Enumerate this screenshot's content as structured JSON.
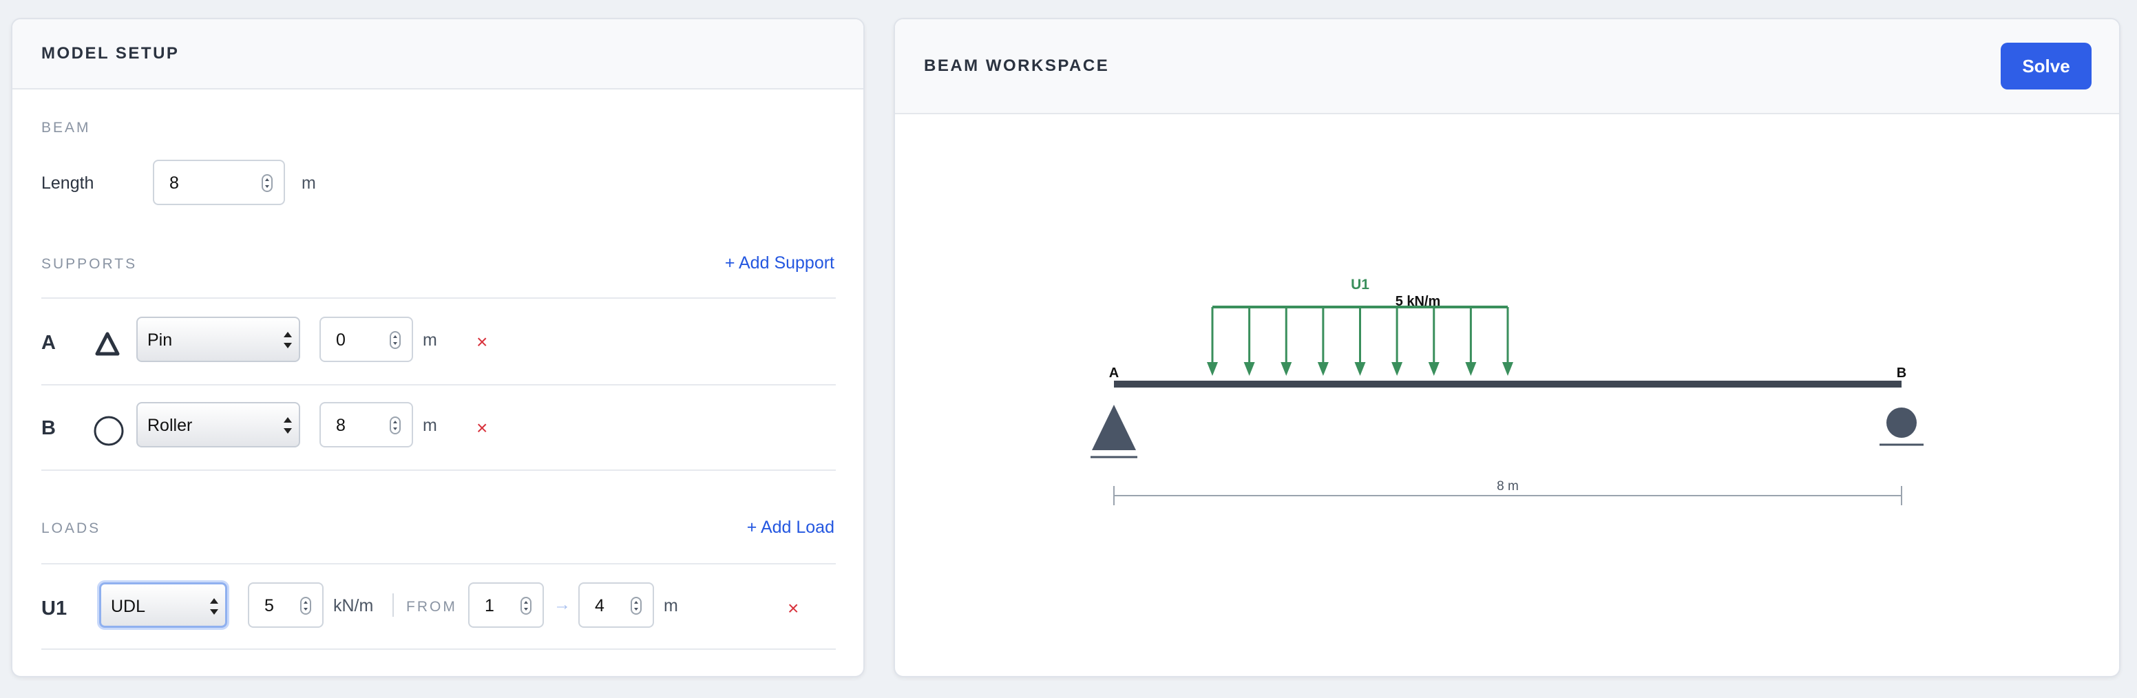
{
  "model_setup": {
    "title": "MODEL SETUP",
    "beam": {
      "section_label": "BEAM",
      "length_label": "Length",
      "length_value": "8",
      "length_unit": "m"
    },
    "supports": {
      "section_label": "SUPPORTS",
      "add_label": "+ Add Support",
      "items": [
        {
          "id": "A",
          "type": "Pin",
          "icon": "pin-triangle-icon",
          "position": "0",
          "unit": "m",
          "delete": "×"
        },
        {
          "id": "B",
          "type": "Roller",
          "icon": "roller-circle-icon",
          "position": "8",
          "unit": "m",
          "delete": "×"
        }
      ]
    },
    "loads": {
      "section_label": "LOADS",
      "add_label": "+ Add Load",
      "items": [
        {
          "id": "U1",
          "type": "UDL",
          "magnitude": "5",
          "magnitude_unit": "kN/m",
          "from_label": "FROM",
          "from": "1",
          "arrow": "→",
          "to": "4",
          "range_unit": "m",
          "delete": "×"
        }
      ]
    }
  },
  "workspace": {
    "title": "BEAM WORKSPACE",
    "solve_label": "Solve"
  },
  "diagram": {
    "beam_length": 8,
    "supports": [
      {
        "label": "A",
        "type": "pin",
        "x": 0
      },
      {
        "label": "B",
        "type": "roller",
        "x": 8
      }
    ],
    "loads": [
      {
        "label": "U1",
        "type": "udl",
        "from": 1,
        "to": 4,
        "text": "5 kN/m"
      }
    ],
    "dimension_label": "8 m",
    "colors": {
      "beam": "#3f4753",
      "load": "#3a8f5c",
      "support": "#4a5566",
      "dimension": "#9aa3ae",
      "accent": "#2f5ee7",
      "delete": "#d8323c"
    }
  }
}
